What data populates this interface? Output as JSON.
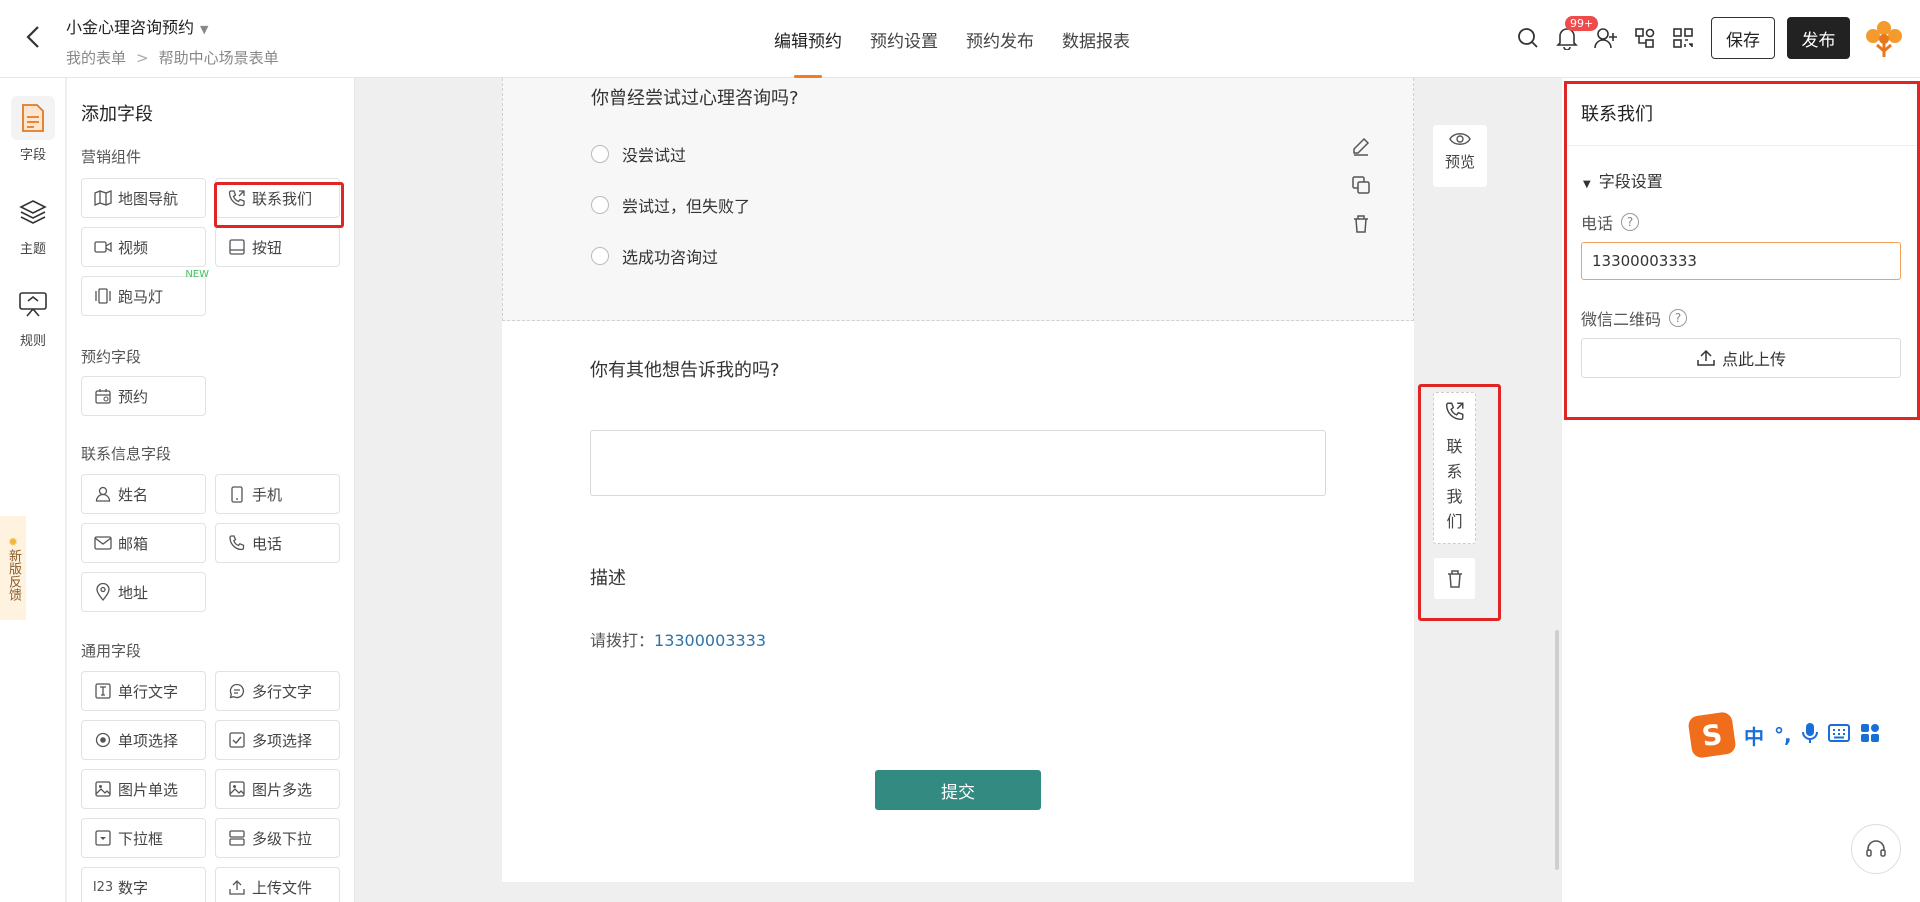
{
  "header": {
    "form_title": "小金心理咨询预约",
    "breadcrumb": [
      "我的表单",
      "帮助中心场景表单"
    ],
    "tabs": [
      {
        "label": "编辑预约",
        "active": true
      },
      {
        "label": "预约设置",
        "active": false
      },
      {
        "label": "预约发布",
        "active": false
      },
      {
        "label": "数据报表",
        "active": false
      }
    ],
    "notification_badge": "99+",
    "save_label": "保存",
    "publish_label": "发布"
  },
  "rail": {
    "items": [
      {
        "label": "字段",
        "icon": "document-icon",
        "active": true
      },
      {
        "label": "主题",
        "icon": "layers-icon",
        "active": false
      },
      {
        "label": "规则",
        "icon": "rule-icon",
        "active": false
      }
    ],
    "feedback": "新版反馈"
  },
  "fields_panel": {
    "title": "添加字段",
    "sections": {
      "marketing": "营销组件",
      "booking": "预约字段",
      "contact": "联系信息字段",
      "general": "通用字段"
    },
    "marketing_items": [
      "地图导航",
      "联系我们",
      "视频",
      "按钮",
      "跑马灯"
    ],
    "new_tag": "NEW",
    "booking_items": [
      "预约"
    ],
    "contact_items": [
      "姓名",
      "手机",
      "邮箱",
      "电话",
      "地址"
    ],
    "general_items": [
      "单行文字",
      "多行文字",
      "单项选择",
      "多项选择",
      "图片单选",
      "图片多选",
      "下拉框",
      "多级下拉",
      "数字",
      "上传文件"
    ]
  },
  "form": {
    "q1": {
      "title": "你曾经尝试过心理咨询吗?",
      "options": [
        "没尝试过",
        "尝试过，但失败了",
        "选成功咨询过"
      ]
    },
    "q2": {
      "title": "你有其他想告诉我的吗?"
    },
    "description": {
      "title": "描述",
      "prefix": "请拨打：",
      "phone": "13300003333"
    },
    "submit_label": "提交"
  },
  "side": {
    "preview_label": "预览",
    "contact_float_label": "联系我们"
  },
  "settings": {
    "title": "联系我们",
    "section": "字段设置",
    "phone_label": "电话",
    "phone_value": "13300003333",
    "wechat_label": "微信二维码",
    "upload_label": "点此上传"
  },
  "ime": {
    "items": [
      "中",
      "°,"
    ]
  },
  "colors": {
    "accent": "#f57a20",
    "submit": "#338a80",
    "highlight": "#e02525",
    "link": "#2f72a8"
  }
}
